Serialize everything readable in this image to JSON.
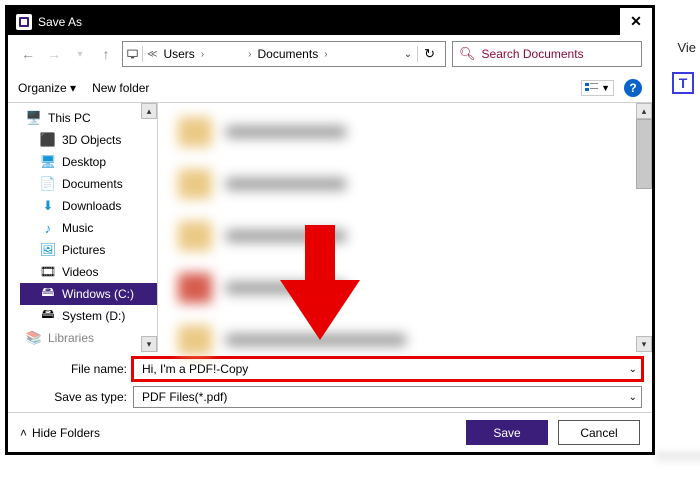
{
  "titlebar": {
    "title": "Save As"
  },
  "nav": {
    "path": {
      "seg1": "Users",
      "seg2": "Documents"
    },
    "search_placeholder": "Search Documents"
  },
  "toolbar": {
    "organize": "Organize",
    "new_folder": "New folder"
  },
  "tree": {
    "this_pc": "This PC",
    "obj3d": "3D Objects",
    "desktop": "Desktop",
    "documents": "Documents",
    "downloads": "Downloads",
    "music": "Music",
    "pictures": "Pictures",
    "videos": "Videos",
    "drive_c": "Windows (C:)",
    "drive_d": "System (D:)",
    "libraries": "Libraries"
  },
  "form": {
    "filename_label": "File name:",
    "filename_value": "Hi, I'm a PDF!-Copy",
    "type_label": "Save as type:",
    "type_value": "PDF Files(*.pdf)"
  },
  "footer": {
    "hide": "Hide Folders",
    "save": "Save",
    "cancel": "Cancel"
  },
  "host": {
    "vie": "Vie",
    "t": "T"
  }
}
